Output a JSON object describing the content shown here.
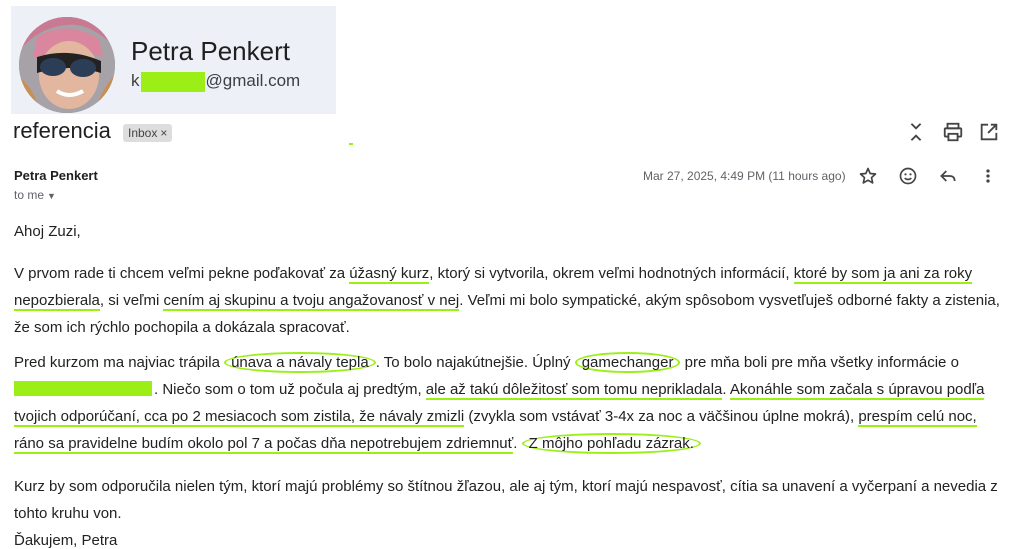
{
  "profile": {
    "name": "Petra Penkert",
    "email_prefix": "k",
    "email_domain": "@gmail.com"
  },
  "thread": {
    "subject": "referencia",
    "label": "Inbox",
    "label_remove": "×"
  },
  "message": {
    "from": "Petra Penkert",
    "to": "to me",
    "date": "Mar 27, 2025, 4:49 PM (11 hours ago)"
  },
  "body": {
    "greeting": "Ahoj Zuzi,",
    "p1": {
      "t1": "V prvom rade ti chcem veľmi pekne poďakovať za ",
      "u1": "úžasný kurz",
      "t2": ", ktorý si vytvorila, okrem veľmi hodnotných informácií, ",
      "u2": "ktoré by som ja ani za roky nepozbierala",
      "t3": ", si veľmi ",
      "u3": "cením aj skupinu a tvoju angažovanosť v nej",
      "t4": ". Veľmi mi bolo sympatické, akým spôsobom vysvetľuješ odborné fakty a zistenia, že som ich rýchlo pochopila a dokázala spracovať."
    },
    "p2": {
      "t1": "Pred kurzom ma najviac trápila ",
      "c1": "únava a návaly tepla",
      "t2": ". To bolo najakútnejšie. Úplný ",
      "c2": "gamechanger",
      "t3": " pre mňa boli pre mňa všetky informácie o ",
      "t4": ". Niečo som o tom už počula aj predtým, ",
      "u1": "ale až takú dôležitosť som tomu neprikladala",
      "t5": ". ",
      "u2": "Akonáhle som začala s úpravou podľa tvojich odporúčaní, cca po 2 mesiacoch som zistila, že návaly zmizli",
      "t6": " (zvykla som vstávať 3-4x za noc a väčšinou úplne mokrá), ",
      "u3": "prespím celú noc, ráno sa pravidelne budím okolo pol 7 a počas dňa nepotrebujem zdriemnuť",
      "t7": ". ",
      "c3": "Z môjho pohľadu zázrak."
    },
    "p3": "Kurz by som odporučila nielen tým, ktorí majú problémy so štítnou žľazou, ale aj tým, ktorí majú nespavosť, cítia sa unavení a vyčerpaní a nevedia z tohto kruhu von.",
    "p4_partial": "Ďakujem, Petra"
  },
  "icons": {
    "top": [
      "expand-collapse-icon",
      "print-icon",
      "open-new-window-icon"
    ],
    "actions": [
      "star-icon",
      "emoji-icon",
      "reply-icon",
      "more-vert-icon"
    ],
    "highlight_color": "#9bef17"
  }
}
